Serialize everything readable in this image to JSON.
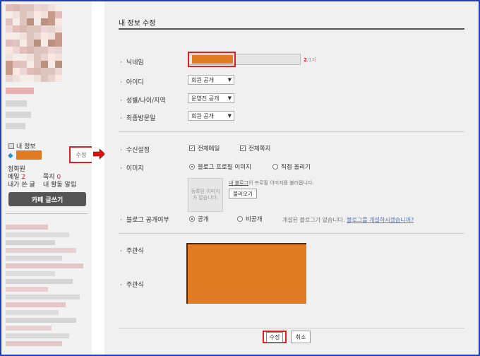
{
  "sidebar": {
    "my_info_label": "내 정보",
    "edit_link": "수정",
    "rank": "정회원",
    "mail_label": "메일",
    "mail_count": "2",
    "note_label": "쪽지",
    "note_count": "0",
    "my_posts": "내가 쓴 글",
    "activity_alert": "내 활동 알림",
    "write_button": "카페 글쓰기"
  },
  "main": {
    "title": "내 정보 수정",
    "nickname_label": "닉네임",
    "nickname_count": "2",
    "nickname_max": "/1자",
    "id_label": "아이디",
    "id_select": "회원 공개",
    "gender_label": "성별/나이/지역",
    "gender_select": "운영진 공개",
    "visit_label": "최종방문일",
    "visit_select": "회원 공개",
    "receive_label": "수신설정",
    "receive_mail": "전체메일",
    "receive_note": "전체쪽지",
    "image_label": "이미지",
    "image_opt_blog": "블로그 프로필 이미지",
    "image_opt_upload": "직접 올리기",
    "no_image_text": "등록된 이미지가 없습니다.",
    "image_note_link": "내 블로그",
    "image_note_rest": "의 프로필 이미지를 불러옵니다.",
    "load_button": "불러오기",
    "blog_label": "블로그 공개여부",
    "blog_public": "공개",
    "blog_private": "비공개",
    "blog_note_text": "개설된 블로그가 없습니다.",
    "blog_note_link": "블로그를 개설하시겠습니까?",
    "interest_label_1": "주관식",
    "interest_label_2": "주관식",
    "save_button": "수정",
    "cancel_button": "취소"
  },
  "colors": {
    "frame": "#1f3fb8",
    "highlight": "#e02020",
    "redacted": "#e07b24",
    "count": "#d22222"
  }
}
